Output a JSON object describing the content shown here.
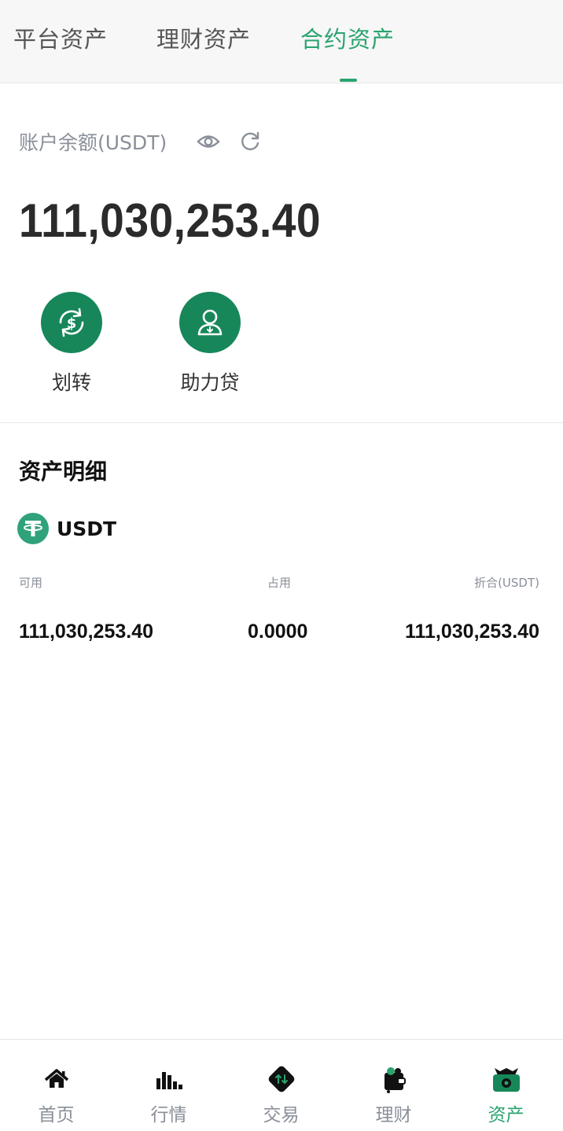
{
  "tabs": [
    {
      "label": "平台资产",
      "active": false
    },
    {
      "label": "理财资产",
      "active": false
    },
    {
      "label": "合约资产",
      "active": true
    }
  ],
  "balance": {
    "label": "账户余额(USDT)",
    "value": "111,030,253.40"
  },
  "actions": [
    {
      "label": "划转",
      "icon": "transfer-dollar-icon"
    },
    {
      "label": "助力贷",
      "icon": "user-loan-icon"
    }
  ],
  "details": {
    "title": "资产明细",
    "coin": {
      "name": "USDT",
      "icon": "tether-icon"
    },
    "columns": [
      "可用",
      "占用",
      "折合(USDT)"
    ],
    "values": [
      "111,030,253.40",
      "0.0000",
      "111,030,253.40"
    ]
  },
  "nav": [
    {
      "label": "首页",
      "icon": "home-icon",
      "active": false
    },
    {
      "label": "行情",
      "icon": "chart-bars-icon",
      "active": false
    },
    {
      "label": "交易",
      "icon": "trade-icon",
      "active": false
    },
    {
      "label": "理财",
      "icon": "wallet-icon",
      "active": false
    },
    {
      "label": "资产",
      "icon": "assets-icon",
      "active": true
    }
  ],
  "colors": {
    "accent": "#2aa36f",
    "button": "#17875a",
    "muted": "#8a8f99"
  }
}
